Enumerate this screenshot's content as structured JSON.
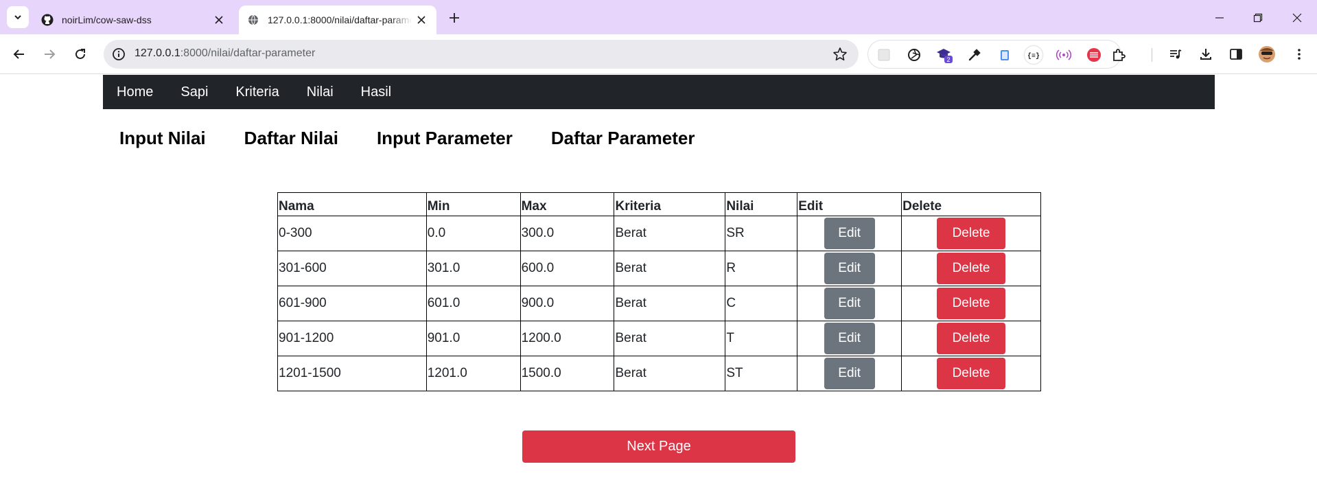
{
  "browser": {
    "tabs": [
      {
        "title": "noirLim/cow-saw-dss",
        "favicon": "github-icon",
        "active": false
      },
      {
        "title": "127.0.0.1:8000/nilai/daftar-parameter",
        "favicon": "globe-icon",
        "active": true
      }
    ],
    "url_host": "127.0.0.1",
    "url_rest": ":8000/nilai/daftar-parameter",
    "extension_badge": "2"
  },
  "navbar": {
    "items": [
      "Home",
      "Sapi",
      "Kriteria",
      "Nilai",
      "Hasil"
    ]
  },
  "subnav": {
    "items": [
      "Input Nilai",
      "Daftar Nilai",
      "Input Parameter",
      "Daftar Parameter"
    ]
  },
  "table": {
    "headers": [
      "Nama",
      "Min",
      "Max",
      "Kriteria",
      "Nilai",
      "Edit",
      "Delete"
    ],
    "rows": [
      {
        "nama": "0-300",
        "min": "0.0",
        "max": "300.0",
        "kriteria": "Berat",
        "nilai": "SR"
      },
      {
        "nama": "301-600",
        "min": "301.0",
        "max": "600.0",
        "kriteria": "Berat",
        "nilai": "R"
      },
      {
        "nama": "601-900",
        "min": "601.0",
        "max": "900.0",
        "kriteria": "Berat",
        "nilai": "C"
      },
      {
        "nama": "901-1200",
        "min": "901.0",
        "max": "1200.0",
        "kriteria": "Berat",
        "nilai": "T"
      },
      {
        "nama": "1201-1500",
        "min": "1201.0",
        "max": "1500.0",
        "kriteria": "Berat",
        "nilai": "ST"
      }
    ],
    "edit_label": "Edit",
    "delete_label": "Delete"
  },
  "next_page_label": "Next Page",
  "colors": {
    "navbar_bg": "#212529",
    "edit_btn": "#6c757d",
    "delete_btn": "#dc3545",
    "tabstrip_bg": "#e8d5fb"
  }
}
